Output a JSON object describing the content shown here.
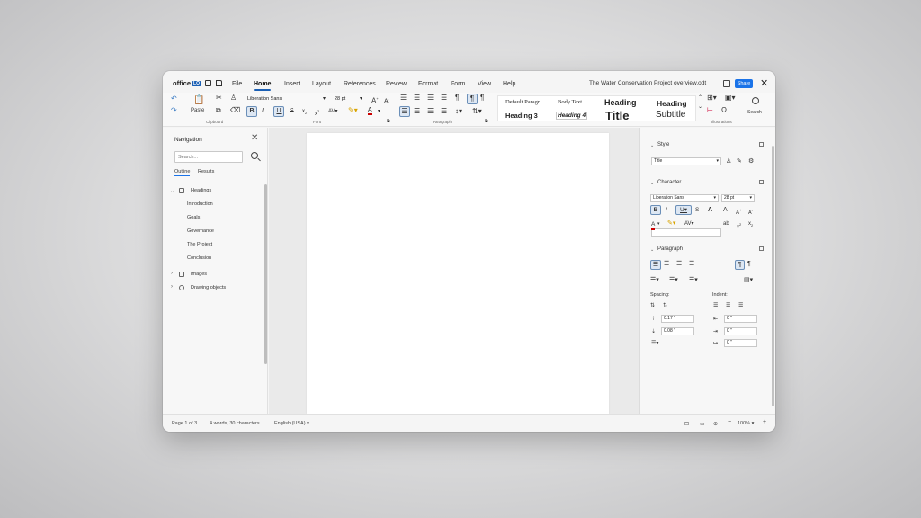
{
  "app": {
    "logo_text": "office",
    "logo_badge": "LO",
    "doc_title": "The Water Conservation Project overview.odt",
    "share_label": "Share"
  },
  "menu": [
    "File",
    "Home",
    "Insert",
    "Layout",
    "References",
    "Review",
    "Format",
    "Form",
    "View",
    "Help"
  ],
  "ribbon": {
    "clipboard_label": "Clipboard",
    "paste_label": "Paste",
    "font_name": "Liberation Sans",
    "font_size": "28 pt",
    "font_label": "Font",
    "paragraph_label": "Paragraph",
    "styles": [
      "Default Paragr",
      "Body Text",
      "Heading",
      "Heading",
      "Heading 3",
      "Heading 4",
      "Title",
      "Subtitle"
    ],
    "illustrations_label": "Illustrations",
    "search_label": "Search"
  },
  "navigator": {
    "title": "Navigation",
    "search_placeholder": "Search...",
    "tabs": [
      "Outline",
      "Results"
    ],
    "headings_label": "Headings",
    "headings": [
      "Introduction",
      "Goals",
      "Governance",
      "The Project",
      "Conclusion"
    ],
    "images_label": "Images",
    "drawing_label": "Drawing objects"
  },
  "sidebar": {
    "style_header": "Style",
    "style_value": "Title",
    "character_header": "Character",
    "char_font": "Liberation Sans",
    "char_size": "28 pt",
    "paragraph_header": "Paragraph",
    "spacing_label": "Spacing:",
    "indent_label": "Indent:",
    "spacing_above": "0.17 \"",
    "spacing_below": "0.08 \"",
    "indent_before": "0 \"",
    "indent_after": "0 \"",
    "indent_first": "0 \""
  },
  "status": {
    "page": "Page 1 of 3",
    "words": "4 words, 30 characters",
    "language": "English (USA)",
    "zoom": "100%"
  }
}
